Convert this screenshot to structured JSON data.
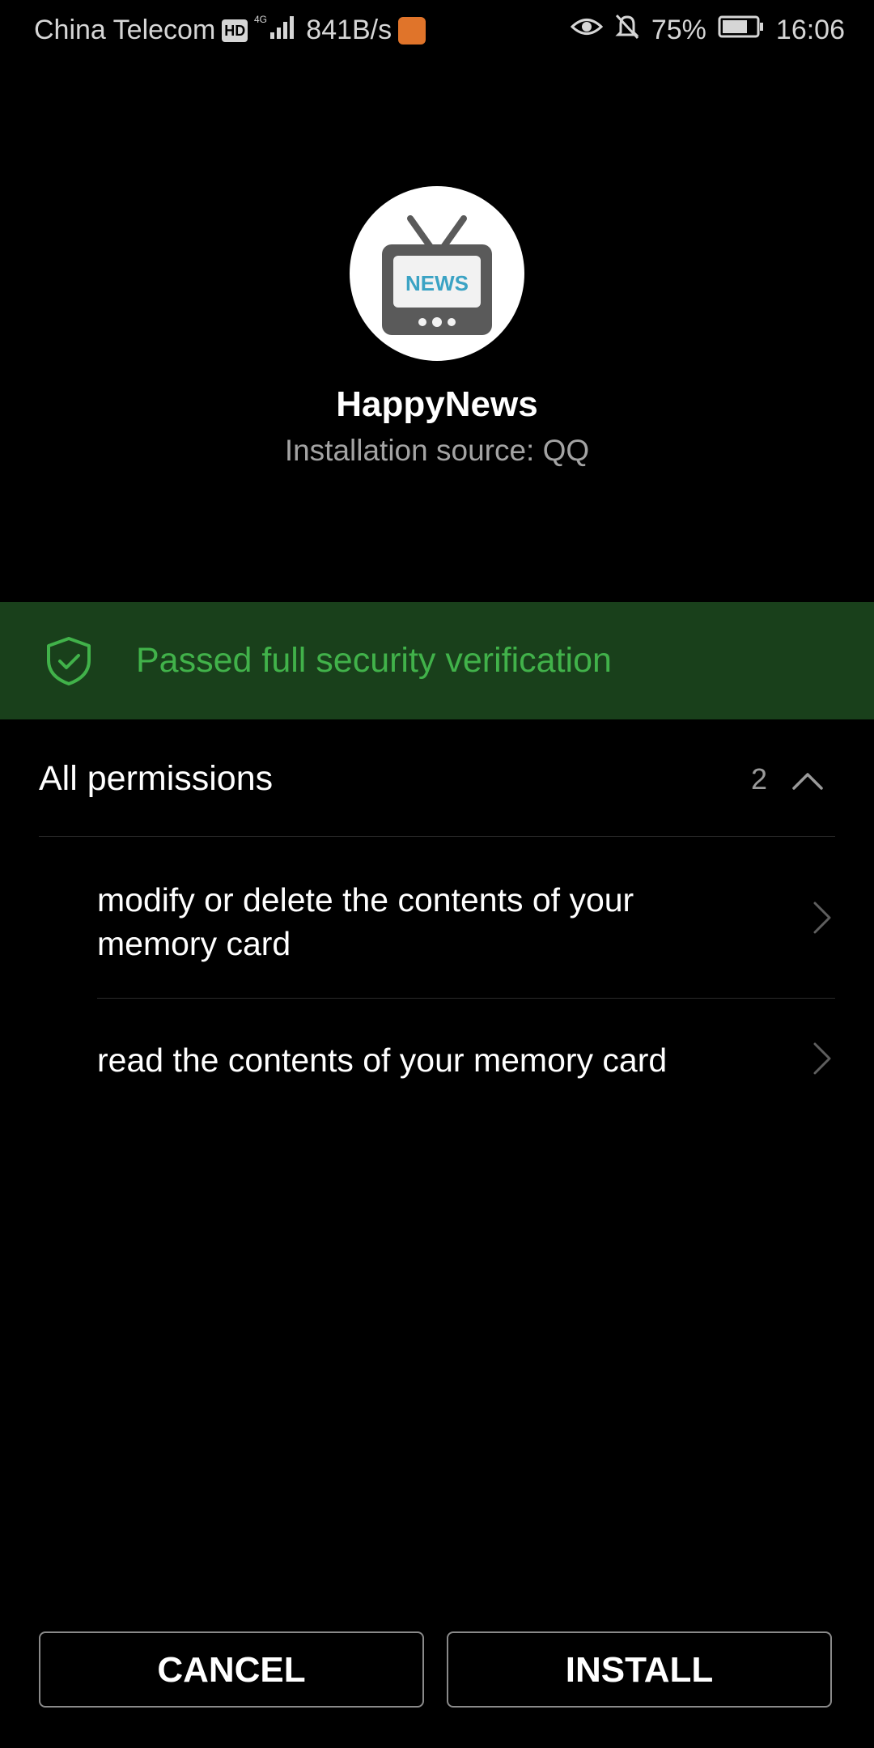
{
  "status_bar": {
    "carrier": "China Telecom",
    "hd": "HD",
    "network": "4G",
    "speed": "841B/s",
    "battery": "75%",
    "time": "16:06"
  },
  "app": {
    "name": "HappyNews",
    "source": "Installation source: QQ",
    "icon_text": "NEWS"
  },
  "security": {
    "text": "Passed full security verification",
    "color": "#41b24a"
  },
  "permissions": {
    "title": "All permissions",
    "count": "2",
    "items": [
      {
        "label": "modify or delete the contents of your memory card"
      },
      {
        "label": "read the contents of your memory card"
      }
    ]
  },
  "buttons": {
    "cancel": "CANCEL",
    "install": "INSTALL"
  }
}
